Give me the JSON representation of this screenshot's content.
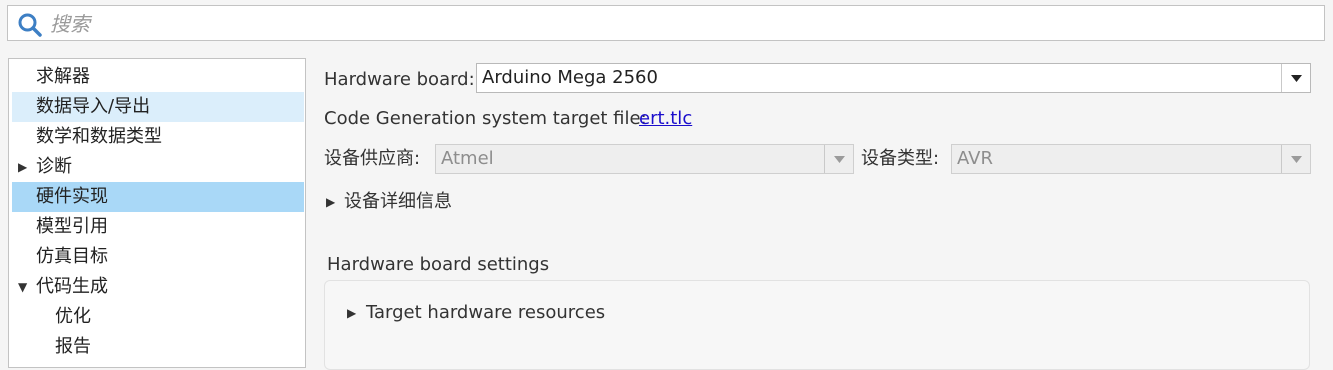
{
  "search": {
    "placeholder": "搜索",
    "icon": "search-icon"
  },
  "sidebar": {
    "items": [
      {
        "label": "求解器"
      },
      {
        "label": "数据导入/导出"
      },
      {
        "label": "数学和数据类型"
      },
      {
        "label": "诊断",
        "caret": "▶"
      },
      {
        "label": "硬件实现"
      },
      {
        "label": "模型引用"
      },
      {
        "label": "仿真目标"
      },
      {
        "label": "代码生成",
        "caret": "▼"
      },
      {
        "label": "优化"
      },
      {
        "label": "报告"
      }
    ]
  },
  "main": {
    "hardware_board": {
      "label": "Hardware board:",
      "value": "Arduino Mega 2560"
    },
    "codegen": {
      "label": "Code Generation system target file:",
      "link": "ert.tlc"
    },
    "vendor": {
      "label": "设备供应商:",
      "value": "Atmel"
    },
    "device_type": {
      "label": "设备类型:",
      "value": "AVR"
    },
    "device_details": {
      "label": "设备详细信息",
      "caret": "▶"
    },
    "board_settings": {
      "title": "Hardware board settings",
      "target_resources": {
        "label": "Target hardware resources",
        "caret": "▶"
      }
    }
  },
  "colors": {
    "selected": "#a9d8f7",
    "hover": "#dbeefb",
    "link": "#1a0dcc",
    "search_icon": "#3d7fc4"
  }
}
